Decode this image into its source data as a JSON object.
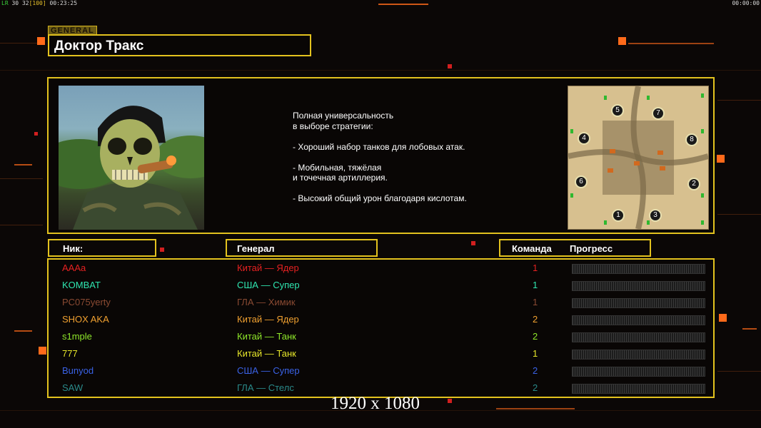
{
  "status_left": {
    "fps_label": "LR",
    "fps": "30",
    "ping": "32",
    "bracket": "[100]",
    "time": "00:23:25"
  },
  "status_right": {
    "time": "00:00:00"
  },
  "general_tag": "GENERAL",
  "general_name": "Доктор Тракс",
  "description": "Полная универсальность\nв выборе стратегии:\n\n- Хороший набор танков для лобовых атак.\n\n- Мобильная, тяжёлая\nи точечная артиллерия.\n\n- Высокий общий урон благодаря кислотам.",
  "headers": {
    "nick": "Ник:",
    "general": "Генерал",
    "team": "Команда",
    "progress": "Прогресс"
  },
  "map_slots": [
    "1",
    "2",
    "3",
    "4",
    "5",
    "6",
    "7",
    "8"
  ],
  "players": [
    {
      "nick": "AAAa",
      "general": "Китай — Ядер",
      "team": "1",
      "color": "#e62121",
      "progress": 0
    },
    {
      "nick": "KOMBAT",
      "general": "США — Супер",
      "team": "1",
      "color": "#2fe6b0",
      "progress": 0
    },
    {
      "nick": "PC075yerty",
      "general": "ГЛА — Химик",
      "team": "1",
      "color": "#8a4a32",
      "progress": 0
    },
    {
      "nick": "SHOX AKA",
      "general": "Китай — Ядер",
      "team": "2",
      "color": "#f0a030",
      "progress": 0
    },
    {
      "nick": "s1mple",
      "general": "Китай — Танк",
      "team": "2",
      "color": "#8ee62a",
      "progress": 0
    },
    {
      "nick": "777",
      "general": "Китай — Танк",
      "team": "1",
      "color": "#e6e62a",
      "progress": 0
    },
    {
      "nick": "Bunyod",
      "general": "США — Супер",
      "team": "2",
      "color": "#3a62e6",
      "progress": 0
    },
    {
      "nick": "SAW",
      "general": "ГЛА — Стелс",
      "team": "2",
      "color": "#2a8a8a",
      "progress": 0
    }
  ],
  "resolution_label": "1920 x 1080"
}
